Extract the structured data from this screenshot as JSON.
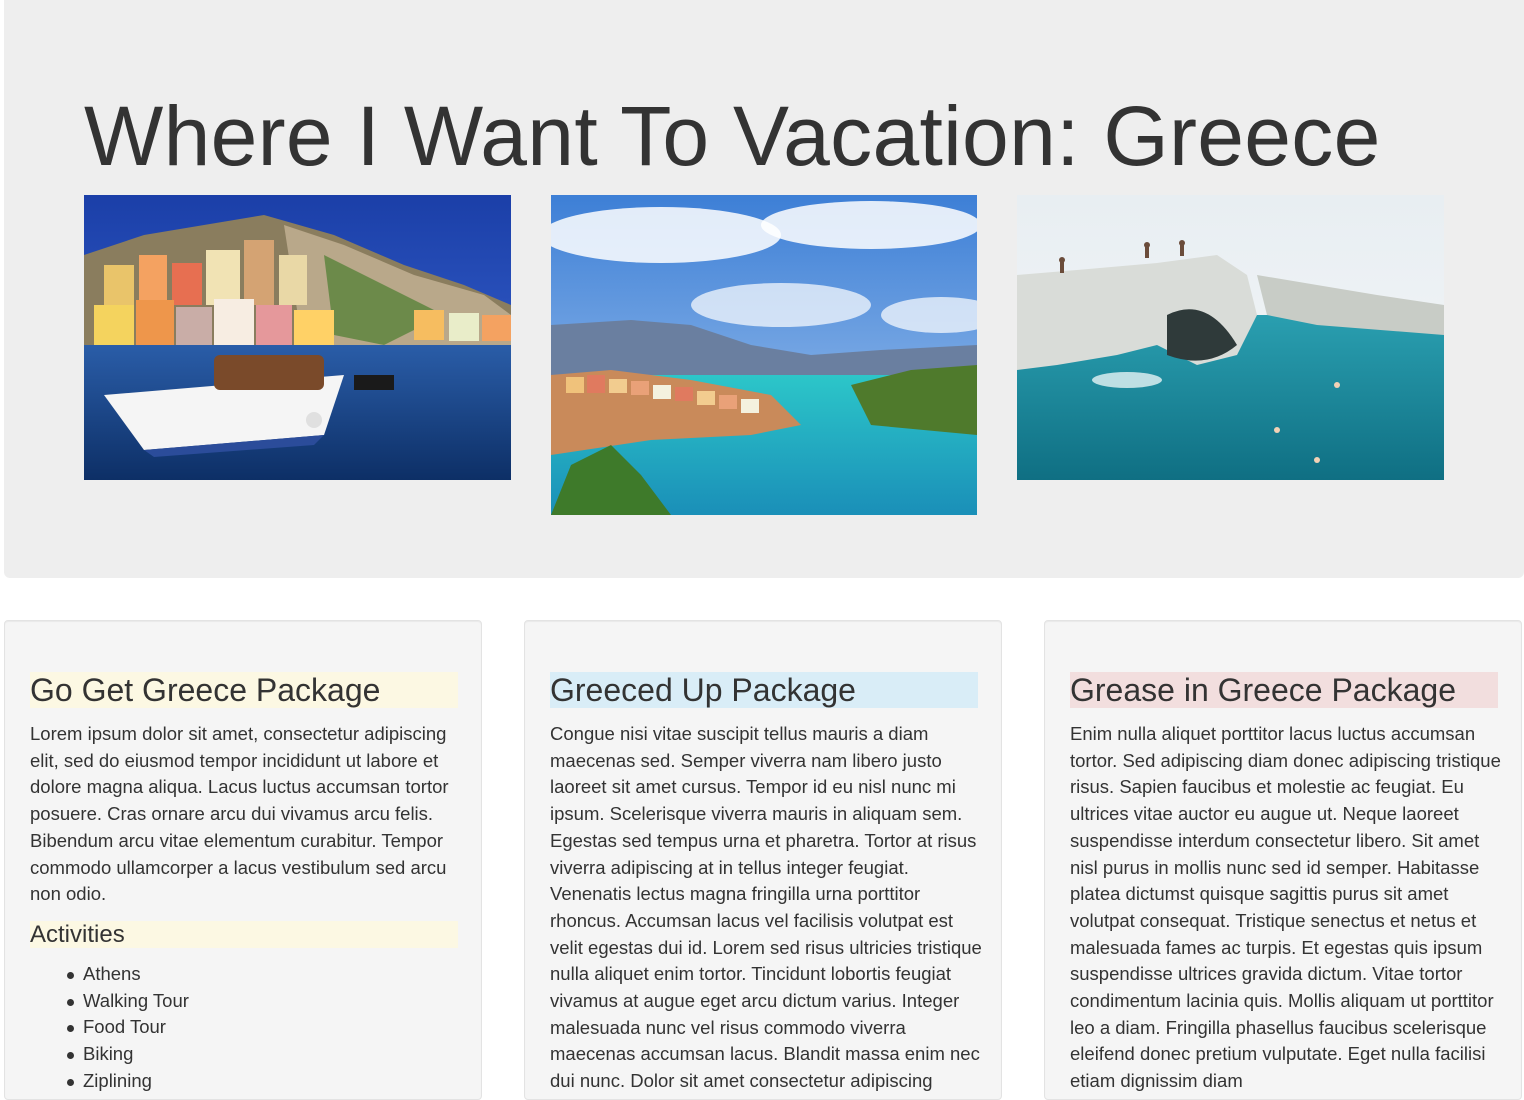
{
  "header": {
    "title": "Where I Want To Vacation: Greece"
  },
  "photos": [
    {
      "name": "harbor-village-photo"
    },
    {
      "name": "bay-village-photo"
    },
    {
      "name": "white-cliffs-sea-photo"
    }
  ],
  "packages": [
    {
      "title": "Go Get Greece Package",
      "text": "Lorem ipsum dolor sit amet, consectetur adipiscing elit, sed do eiusmod tempor incididunt ut labore et dolore magna aliqua. Lacus luctus accumsan tortor posuere. Cras ornare arcu dui vivamus arcu felis. Bibendum arcu vitae elementum curabitur. Tempor commodo ullamcorper a lacus vestibulum sed arcu non odio.",
      "activities_title": "Activities",
      "activities": [
        "Athens",
        "Walking Tour",
        "Food Tour",
        "Biking",
        "Ziplining"
      ],
      "highlight_color": "#fcf8e3"
    },
    {
      "title": "Greeced Up Package",
      "text": "Congue nisi vitae suscipit tellus mauris a diam maecenas sed. Semper viverra nam libero justo laoreet sit amet cursus. Tempor id eu nisl nunc mi ipsum. Scelerisque viverra mauris in aliquam sem. Egestas sed tempus urna et pharetra. Tortor at risus viverra adipiscing at in tellus integer feugiat. Venenatis lectus magna fringilla urna porttitor rhoncus. Accumsan lacus vel facilisis volutpat est velit egestas dui id. Lorem sed risus ultricies tristique nulla aliquet enim tortor. Tincidunt lobortis feugiat vivamus at augue eget arcu dictum varius. Integer malesuada nunc vel risus commodo viverra maecenas accumsan lacus. Blandit massa enim nec dui nunc. Dolor sit amet consectetur adipiscing",
      "highlight_color": "#d9edf7"
    },
    {
      "title": "Grease in Greece Package",
      "text": "Enim nulla aliquet porttitor lacus luctus accumsan tortor. Sed adipiscing diam donec adipiscing tristique risus. Sapien faucibus et molestie ac feugiat. Eu ultrices vitae auctor eu augue ut. Neque laoreet suspendisse interdum consectetur libero. Sit amet nisl purus in mollis nunc sed id semper. Habitasse platea dictumst quisque sagittis purus sit amet volutpat consequat. Tristique senectus et netus et malesuada fames ac turpis. Et egestas quis ipsum suspendisse ultrices gravida dictum. Vitae tortor condimentum lacinia quis. Mollis aliquam ut porttitor leo a diam. Fringilla phasellus faucibus scelerisque eleifend donec pretium vulputate. Eget nulla facilisi etiam dignissim diam",
      "highlight_color": "#f2dede"
    }
  ],
  "colors": {
    "jumbotron_bg": "#eeeeee",
    "panel_bg": "#f5f5f5",
    "text": "#333333"
  }
}
